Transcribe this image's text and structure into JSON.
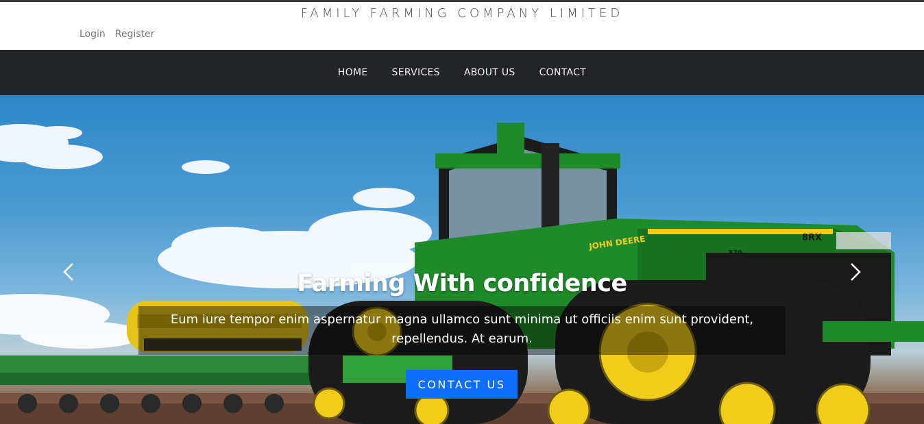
{
  "header": {
    "brand": "FAMILY FARMING COMPANY LIMITED",
    "login": "Login",
    "register": "Register"
  },
  "nav": {
    "items": [
      {
        "label": "HOME"
      },
      {
        "label": "SERVICES"
      },
      {
        "label": "ABOUT US"
      },
      {
        "label": "CONTACT"
      }
    ]
  },
  "hero": {
    "title": "Farming With confidence",
    "text": "Eum iure tempor enim aspernatur magna ullamco sunt minima ut officiis enim sunt provident, repellendus. At earum.",
    "cta": "CONTACT US",
    "prev_icon": "chevron-left-icon",
    "next_icon": "chevron-right-icon",
    "tractor_badge": "JOHN DEERE",
    "tractor_model": "8RX",
    "tractor_number": "370"
  },
  "colors": {
    "nav_bg": "#222427",
    "cta_bg": "#0d6efd",
    "tractor_green": "#1f8a2a",
    "tractor_yellow": "#f2cc1b"
  }
}
